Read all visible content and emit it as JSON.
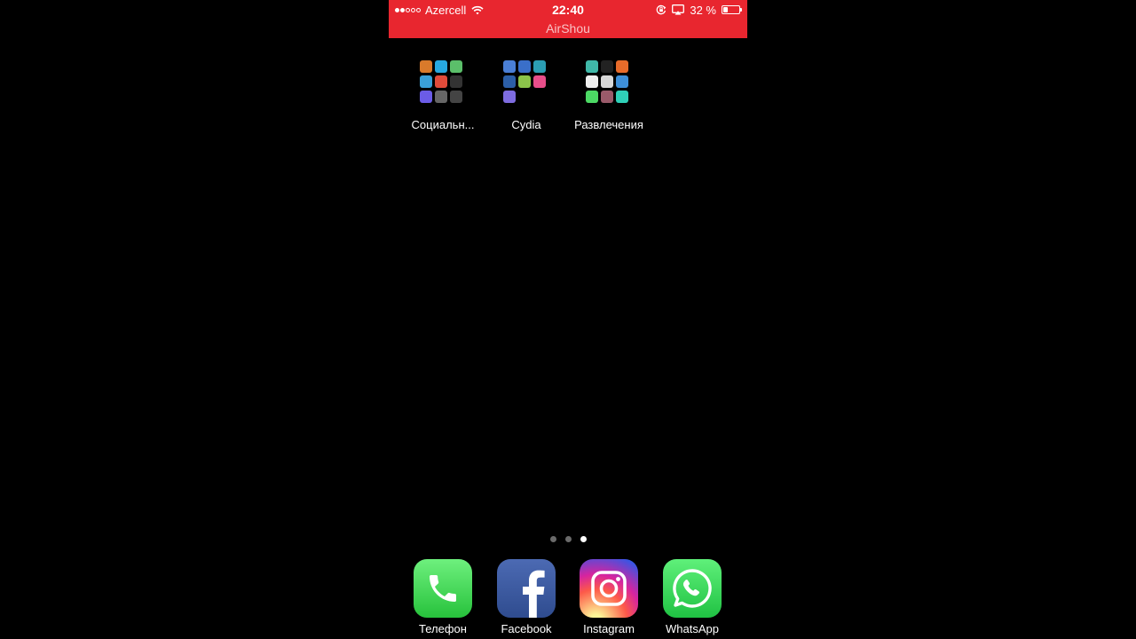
{
  "status_bar": {
    "carrier": "Azercell",
    "time": "22:40",
    "battery_percent": "32 %",
    "battery_level": 0.32,
    "signal_bars_filled": 2,
    "signal_bars_total": 5,
    "recording_app": "AirShou",
    "background_color": "#e8262f"
  },
  "folders": [
    {
      "label": "Социальн...",
      "mini_icon_colors": [
        "#d97a2b",
        "#27a8e0",
        "#5bbf6a",
        "#3aa0d8",
        "#e04b3a",
        "#333333",
        "#6b5ce7",
        "#666666",
        "#444444"
      ]
    },
    {
      "label": "Cydia",
      "mini_icon_colors": [
        "#4a7fd6",
        "#3a6fc9",
        "#2b9db3",
        "#2c5fa8",
        "#8bc34a",
        "#e84e8a",
        "#7e6ce0"
      ]
    },
    {
      "label": "Развлечения",
      "mini_icon_colors": [
        "#3fb8a8",
        "#222222",
        "#e86b2a",
        "#eeeeee",
        "#d8d8d8",
        "#3e8fd8",
        "#4cd964",
        "#9a5a6a",
        "#2fd0b8"
      ]
    }
  ],
  "page_indicator": {
    "count": 3,
    "active": 2
  },
  "dock": [
    {
      "label": "Телефон",
      "icon": "phone-icon",
      "color": "#4cd964"
    },
    {
      "label": "Facebook",
      "icon": "facebook-icon",
      "color": "#3b5998"
    },
    {
      "label": "Instagram",
      "icon": "instagram-icon",
      "color": "#d6249f"
    },
    {
      "label": "WhatsApp",
      "icon": "whatsapp-icon",
      "color": "#2fd05a"
    }
  ]
}
